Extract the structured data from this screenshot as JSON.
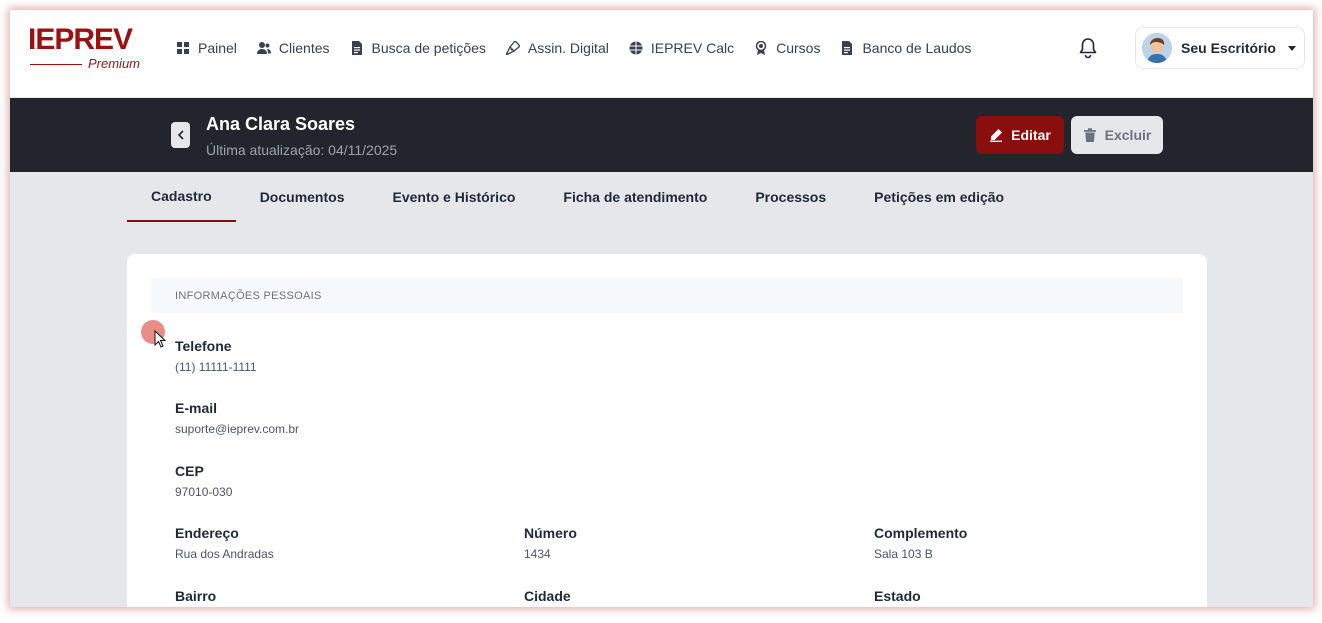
{
  "brand": {
    "name": "IEPREV",
    "tier": "Premium",
    "color": "#9b1111"
  },
  "nav": {
    "items": [
      {
        "label": "Painel",
        "icon": "grid-icon"
      },
      {
        "label": "Clientes",
        "icon": "users-icon"
      },
      {
        "label": "Busca de petições",
        "icon": "document-icon"
      },
      {
        "label": "Assin. Digital",
        "icon": "pen-nib-icon"
      },
      {
        "label": "IEPREV Calc",
        "icon": "globe-icon"
      },
      {
        "label": "Cursos",
        "icon": "award-icon"
      },
      {
        "label": "Banco de Laudos",
        "icon": "document-icon"
      }
    ],
    "notifications_icon": "bell-icon",
    "user": {
      "name": "Seu Escritório"
    }
  },
  "client": {
    "name": "Ana Clara Soares",
    "updated": "Última atualização: 04/11/2025"
  },
  "actions": {
    "edit": "Editar",
    "delete": "Excluir"
  },
  "tabs": [
    {
      "label": "Cadastro",
      "active": true
    },
    {
      "label": "Documentos"
    },
    {
      "label": "Evento e Histórico"
    },
    {
      "label": "Ficha de atendimento"
    },
    {
      "label": "Processos"
    },
    {
      "label": "Petições em edição"
    }
  ],
  "section": {
    "title": "INFORMAÇÕES PESSOAIS",
    "fields": {
      "telefone": {
        "label": "Telefone",
        "value": "(11) 11111-1111"
      },
      "email": {
        "label": "E-mail",
        "value": "suporte@ieprev.com.br"
      },
      "cep": {
        "label": "CEP",
        "value": "97010-030"
      },
      "endereco": {
        "label": "Endereço",
        "value": "Rua dos Andradas"
      },
      "numero": {
        "label": "Número",
        "value": "1434"
      },
      "complemento": {
        "label": "Complemento",
        "value": "Sala 103 B"
      },
      "bairro": {
        "label": "Bairro"
      },
      "cidade": {
        "label": "Cidade"
      },
      "estado": {
        "label": "Estado"
      }
    }
  },
  "colors": {
    "accent": "#8b0e0e",
    "header_bg": "#22252b",
    "page_bg": "#e5e7eb"
  }
}
